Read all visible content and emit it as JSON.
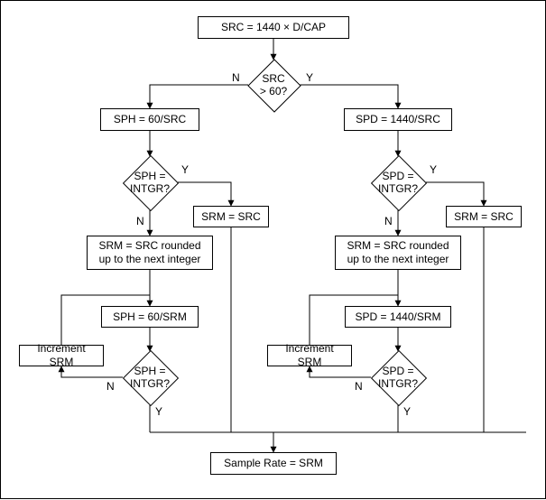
{
  "chart_data": {
    "type": "flowchart",
    "nodes": [
      {
        "id": "n_top",
        "kind": "process",
        "text": "SRC = 1440 × D/CAP"
      },
      {
        "id": "d_src60",
        "kind": "decision",
        "text": "SRC\n> 60?"
      },
      {
        "id": "n_sph_eq",
        "kind": "process",
        "text": "SPH = 60/SRC"
      },
      {
        "id": "n_spd_eq",
        "kind": "process",
        "text": "SPD = 1440/SRC"
      },
      {
        "id": "d_sph_int",
        "kind": "decision",
        "text": "SPH =\nINTGR?"
      },
      {
        "id": "d_spd_int",
        "kind": "decision",
        "text": "SPD =\nINTGR?"
      },
      {
        "id": "n_srmL1",
        "kind": "process",
        "text": "SRM = SRC"
      },
      {
        "id": "n_srmR1",
        "kind": "process",
        "text": "SRM = SRC"
      },
      {
        "id": "n_roundL",
        "kind": "process",
        "text": "SRM = SRC rounded up to the next integer"
      },
      {
        "id": "n_roundR",
        "kind": "process",
        "text": "SRM = SRC rounded up to the next integer"
      },
      {
        "id": "n_sph2",
        "kind": "process",
        "text": "SPH = 60/SRM"
      },
      {
        "id": "n_spd2",
        "kind": "process",
        "text": "SPD = 1440/SRM"
      },
      {
        "id": "n_incL",
        "kind": "process",
        "text": "Increment SRM"
      },
      {
        "id": "n_incR",
        "kind": "process",
        "text": "Increment SRM"
      },
      {
        "id": "d_sph_int2",
        "kind": "decision",
        "text": "SPH =\nINTGR?"
      },
      {
        "id": "d_spd_int2",
        "kind": "decision",
        "text": "SPD =\nINTGR?"
      },
      {
        "id": "n_final",
        "kind": "process",
        "text": "Sample Rate = SRM"
      }
    ],
    "edges": [
      {
        "from": "n_top",
        "to": "d_src60"
      },
      {
        "from": "d_src60",
        "to": "n_sph_eq",
        "label": "N"
      },
      {
        "from": "d_src60",
        "to": "n_spd_eq",
        "label": "Y"
      },
      {
        "from": "n_sph_eq",
        "to": "d_sph_int"
      },
      {
        "from": "n_spd_eq",
        "to": "d_spd_int"
      },
      {
        "from": "d_sph_int",
        "to": "n_srmL1",
        "label": "Y"
      },
      {
        "from": "d_spd_int",
        "to": "n_srmR1",
        "label": "Y"
      },
      {
        "from": "d_sph_int",
        "to": "n_roundL",
        "label": "N"
      },
      {
        "from": "d_spd_int",
        "to": "n_roundR",
        "label": "N"
      },
      {
        "from": "n_roundL",
        "to": "n_sph2"
      },
      {
        "from": "n_roundR",
        "to": "n_spd2"
      },
      {
        "from": "n_sph2",
        "to": "d_sph_int2"
      },
      {
        "from": "n_spd2",
        "to": "d_spd_int2"
      },
      {
        "from": "d_sph_int2",
        "to": "n_incL",
        "label": "N"
      },
      {
        "from": "d_spd_int2",
        "to": "n_incR",
        "label": "N"
      },
      {
        "from": "n_incL",
        "to": "n_sph2"
      },
      {
        "from": "n_incR",
        "to": "n_spd2"
      },
      {
        "from": "d_sph_int2",
        "to": "n_final",
        "label": "Y"
      },
      {
        "from": "d_spd_int2",
        "to": "n_final",
        "label": "Y"
      },
      {
        "from": "n_srmL1",
        "to": "n_final"
      },
      {
        "from": "n_srmR1",
        "to": "n_final"
      }
    ]
  },
  "labels": {
    "Y": "Y",
    "N": "N"
  }
}
